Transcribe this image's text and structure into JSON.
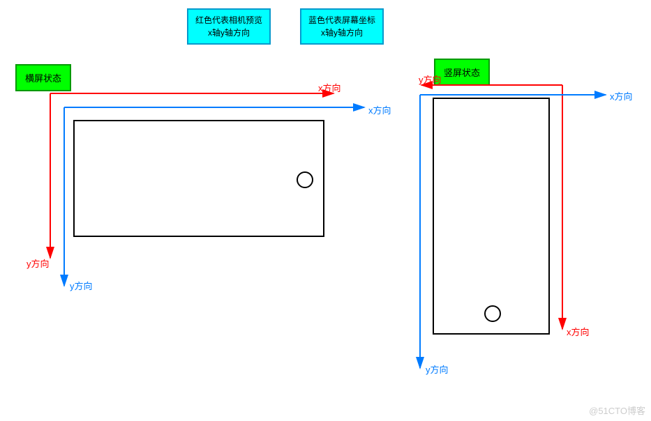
{
  "legend": {
    "red": {
      "line1": "红色代表相机预览",
      "line2": "x轴y轴方向"
    },
    "blue": {
      "line1": "蓝色代表屏幕坐标",
      "line2": "x轴y轴方向"
    }
  },
  "states": {
    "landscape": "横屏状态",
    "portrait": "竖屏状态"
  },
  "axes": {
    "x_label": "x方向",
    "y_label": "y方向"
  },
  "watermark": "@51CTO博客",
  "colors": {
    "red": "#ff0000",
    "blue": "#007bff",
    "green_bg": "#00ff00",
    "cyan_bg": "#00ffff"
  }
}
